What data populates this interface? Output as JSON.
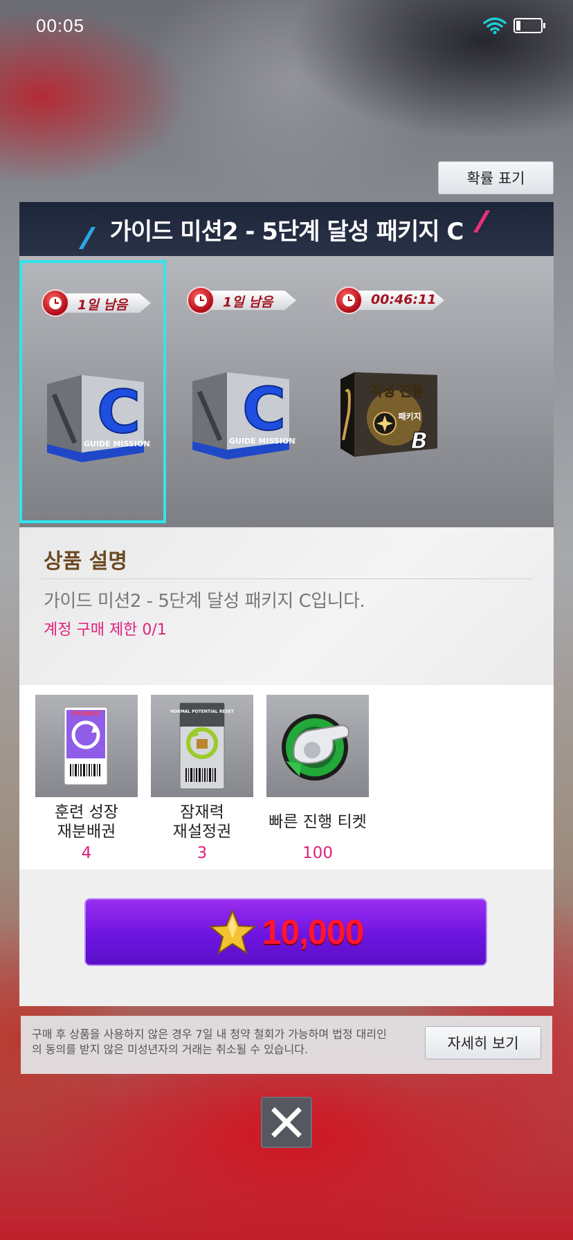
{
  "status_bar": {
    "time": "00:05",
    "battery_level": "25",
    "battery_fraction": 0.25,
    "icons": [
      "wifi-icon",
      "battery-icon"
    ]
  },
  "probability_button": "확률 표기",
  "package": {
    "title": "가이드 미션2 - 5단계 달성 패키지 C",
    "items": [
      {
        "timer": "1일 남음",
        "box": "guide-mission2-c-box",
        "box_letter": "C",
        "box_caption": "GUIDE MISSION2"
      },
      {
        "timer": "1일 남음",
        "box": "guide-mission2-c-box",
        "box_letter": "C",
        "box_caption": "GUIDE MISSION2"
      },
      {
        "timer": "00:46:11",
        "box": "awakening-package-b-box",
        "box_line1": "각성 진행",
        "box_line2": "패키지",
        "box_letter": "B"
      }
    ]
  },
  "description": {
    "heading": "상품 설명",
    "text": "가이드 미션2 - 5단계 달성 패키지 C입니다.",
    "limit": "계정 구매 제한 0/1"
  },
  "rewards": [
    {
      "name": "훈련 성장\n재분배권",
      "count": "4",
      "icon": "training-redistribution-ticket-icon",
      "card_label": "CHANGE"
    },
    {
      "name": "잠재력\n재설정권",
      "count": "3",
      "icon": "potential-reset-ticket-icon",
      "card_label": "NORMAL POTENTIAL RESET"
    },
    {
      "name": "빠른 진행 티켓",
      "count": "100",
      "icon": "whistle-icon"
    }
  ],
  "purchase": {
    "price": "10,000",
    "currency_icon": "star-icon"
  },
  "notice": {
    "text": "구매 후 상품을 사용하지 않은 경우 7일 내 청약 철회가 가능하며 법정 대리인의 동의를 받지 않은 미성년자의 거래는 취소될 수 있습니다.",
    "detail_button": "자세히 보기"
  },
  "close_icon": "close-icon",
  "colors": {
    "selection": "#2ee6ee",
    "accent_pink": "#e0207a",
    "purchase_button": "#7a1ce8",
    "price": "#ff1530",
    "title_bar": "#1c2538"
  }
}
